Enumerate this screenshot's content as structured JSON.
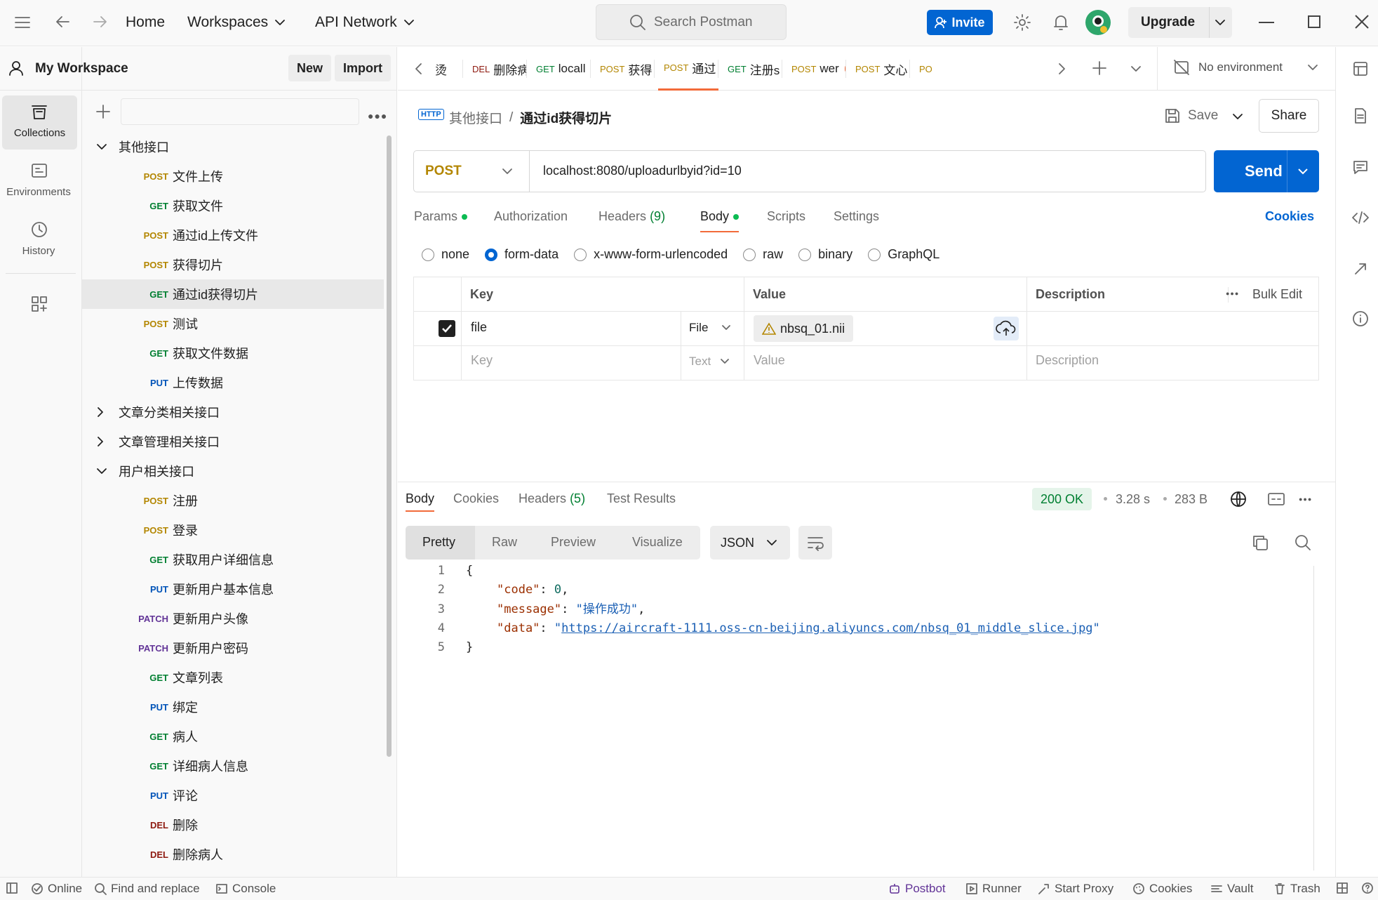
{
  "topbar": {
    "nav": {
      "home": "Home",
      "workspaces": "Workspaces",
      "api_network": "API Network"
    },
    "search_placeholder": "Search Postman",
    "invite": "Invite",
    "upgrade": "Upgrade"
  },
  "rail": {
    "collections": "Collections",
    "environments": "Environments",
    "history": "History"
  },
  "sidebar": {
    "workspace": "My Workspace",
    "new": "New",
    "import": "Import",
    "tree": [
      {
        "type": "folder",
        "label": "其他接口",
        "open": true
      },
      {
        "type": "req",
        "method": "POST",
        "label": "文件上传"
      },
      {
        "type": "req",
        "method": "GET",
        "label": "获取文件"
      },
      {
        "type": "req",
        "method": "POST",
        "label": "通过id上传文件"
      },
      {
        "type": "req",
        "method": "POST",
        "label": "获得切片"
      },
      {
        "type": "req",
        "method": "GET",
        "label": "通过id获得切片",
        "selected": true
      },
      {
        "type": "req",
        "method": "POST",
        "label": "测试"
      },
      {
        "type": "req",
        "method": "GET",
        "label": "获取文件数据"
      },
      {
        "type": "req",
        "method": "PUT",
        "label": "上传数据"
      },
      {
        "type": "folder",
        "label": "文章分类相关接口",
        "open": false
      },
      {
        "type": "folder",
        "label": "文章管理相关接口",
        "open": false
      },
      {
        "type": "folder",
        "label": "用户相关接口",
        "open": true
      },
      {
        "type": "req",
        "method": "POST",
        "label": "注册"
      },
      {
        "type": "req",
        "method": "POST",
        "label": "登录"
      },
      {
        "type": "req",
        "method": "GET",
        "label": "获取用户详细信息"
      },
      {
        "type": "req",
        "method": "PUT",
        "label": "更新用户基本信息"
      },
      {
        "type": "req",
        "method": "PATCH",
        "label": "更新用户头像"
      },
      {
        "type": "req",
        "method": "PATCH",
        "label": "更新用户密码"
      },
      {
        "type": "req",
        "method": "GET",
        "label": "文章列表"
      },
      {
        "type": "req",
        "method": "PUT",
        "label": "绑定"
      },
      {
        "type": "req",
        "method": "GET",
        "label": "病人"
      },
      {
        "type": "req",
        "method": "GET",
        "label": "详细病人信息"
      },
      {
        "type": "req",
        "method": "PUT",
        "label": "评论"
      },
      {
        "type": "req",
        "method": "DEL",
        "label": "删除"
      },
      {
        "type": "req",
        "method": "DEL",
        "label": "删除病人"
      }
    ]
  },
  "tabs": [
    {
      "method": "",
      "label": "烫",
      "dot": false
    },
    {
      "method": "DEL",
      "label": "删除病",
      "dot": false
    },
    {
      "method": "GET",
      "label": "locall",
      "dot": true
    },
    {
      "method": "POST",
      "label": "获得",
      "dot": true
    },
    {
      "method": "POST",
      "label": "通过",
      "dot": true,
      "active": true
    },
    {
      "method": "GET",
      "label": "注册s",
      "dot": false
    },
    {
      "method": "POST",
      "label": "wer",
      "dot": true
    },
    {
      "method": "POST",
      "label": "文心",
      "dot": false
    },
    {
      "method": "PO",
      "label": "",
      "dot": false
    }
  ],
  "environment": "No environment",
  "request": {
    "breadcrumb_parent": "其他接口",
    "breadcrumb_current": "通过id获得切片",
    "save": "Save",
    "share": "Share",
    "method": "POST",
    "url": "localhost:8080/uploadurlbyid?id=10",
    "send": "Send",
    "tabs": {
      "params": "Params",
      "authorization": "Authorization",
      "headers": "Headers",
      "headers_count": "(9)",
      "body": "Body",
      "scripts": "Scripts",
      "settings": "Settings"
    },
    "cookies": "Cookies",
    "body_modes": [
      "none",
      "form-data",
      "x-www-form-urlencoded",
      "raw",
      "binary",
      "GraphQL"
    ],
    "body_mode_selected": "form-data",
    "table": {
      "headers": {
        "key": "Key",
        "value": "Value",
        "description": "Description",
        "bulk_edit": "Bulk Edit"
      },
      "row": {
        "key": "file",
        "type": "File",
        "value": "nbsq_01.nii"
      },
      "empty": {
        "key": "Key",
        "type": "Text",
        "value": "Value",
        "description": "Description"
      }
    }
  },
  "response": {
    "tabs": {
      "body": "Body",
      "cookies": "Cookies",
      "headers": "Headers",
      "headers_count": "(5)",
      "tests": "Test Results"
    },
    "status": "200 OK",
    "time": "3.28 s",
    "size": "283 B",
    "views": {
      "pretty": "Pretty",
      "raw": "Raw",
      "preview": "Preview",
      "visualize": "Visualize"
    },
    "format": "JSON",
    "code_lines": [
      {
        "n": "1",
        "text": "{"
      },
      {
        "n": "2",
        "key": "\"code\"",
        "num": "0",
        "tail": ","
      },
      {
        "n": "3",
        "key": "\"message\"",
        "str": "\"操作成功\"",
        "tail": ","
      },
      {
        "n": "4",
        "key": "\"data\"",
        "url": "https://aircraft-1111.oss-cn-beijing.aliyuncs.com/nbsq_01_middle_slice.jpg"
      },
      {
        "n": "5",
        "text": "}"
      }
    ]
  },
  "statusbar": {
    "online": "Online",
    "find_replace": "Find and replace",
    "console": "Console",
    "postbot": "Postbot",
    "runner": "Runner",
    "start_proxy": "Start Proxy",
    "cookies": "Cookies",
    "vault": "Vault",
    "trash": "Trash"
  },
  "colors": {
    "accent": "#0265d2",
    "orange": "#f26b3a",
    "post": "#b38600",
    "get": "#007f31",
    "put": "#0053b8",
    "patch": "#623497",
    "del": "#8e1a10",
    "status_ok": "#007f31"
  }
}
